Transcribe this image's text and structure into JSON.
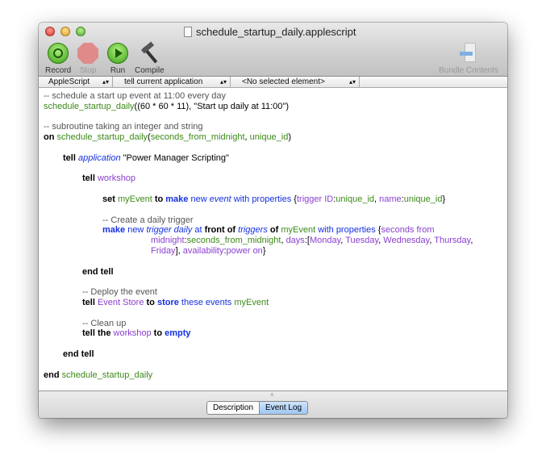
{
  "window": {
    "title": "schedule_startup_daily.applescript"
  },
  "toolbar": {
    "record": "Record",
    "stop": "Stop",
    "run": "Run",
    "compile": "Compile",
    "bundle": "Bundle Contents"
  },
  "navbar": {
    "language": "AppleScript",
    "target": "tell current application",
    "element": "<No selected element>"
  },
  "bottom_tabs": {
    "description": "Description",
    "event_log": "Event Log",
    "selected": "Event Log"
  },
  "colors": {
    "keyword": "#000000",
    "command": "#1530e0",
    "property": "#8a3fd0",
    "variable": "#3c8a18",
    "comment": "#555555"
  },
  "code": [
    {
      "i": 0,
      "t": [
        [
          "-- schedule a start up event at 11:00 every day",
          "c"
        ]
      ]
    },
    {
      "i": 0,
      "t": [
        [
          "schedule_startup_daily",
          "g"
        ],
        [
          "((60 * 60 * 11), \"Start up daily at 11:00\")",
          "n"
        ]
      ]
    },
    {
      "i": 0,
      "t": []
    },
    {
      "i": 0,
      "t": [
        [
          "-- subroutine taking an integer and string",
          "c"
        ]
      ]
    },
    {
      "i": 0,
      "t": [
        [
          "on",
          "k"
        ],
        [
          " ",
          "n"
        ],
        [
          "schedule_startup_daily",
          "g"
        ],
        [
          "(",
          "n"
        ],
        [
          "seconds_from_midnight",
          "g"
        ],
        [
          ", ",
          "n"
        ],
        [
          "unique_id",
          "g"
        ],
        [
          ")",
          "n"
        ]
      ]
    },
    {
      "i": 0,
      "t": []
    },
    {
      "i": 1,
      "t": [
        [
          "tell",
          "k"
        ],
        [
          " ",
          "n"
        ],
        [
          "application",
          "bi"
        ],
        [
          " \"Power Manager Scripting\"",
          "n"
        ]
      ]
    },
    {
      "i": 1,
      "t": []
    },
    {
      "i": 2,
      "t": [
        [
          "tell",
          "k"
        ],
        [
          " ",
          "n"
        ],
        [
          "workshop",
          "p"
        ]
      ]
    },
    {
      "i": 2,
      "t": []
    },
    {
      "i": 3,
      "t": [
        [
          "set",
          "k"
        ],
        [
          " ",
          "n"
        ],
        [
          "myEvent",
          "g"
        ],
        [
          " ",
          "n"
        ],
        [
          "to",
          "k"
        ],
        [
          " ",
          "n"
        ],
        [
          "make",
          "kb"
        ],
        [
          " new ",
          "b"
        ],
        [
          "event",
          "bi"
        ],
        [
          " with properties ",
          "b"
        ],
        [
          "{",
          "n"
        ],
        [
          "trigger ID",
          "p"
        ],
        [
          ":",
          "n"
        ],
        [
          "unique_id",
          "g"
        ],
        [
          ", ",
          "n"
        ],
        [
          "name",
          "p"
        ],
        [
          ":",
          "n"
        ],
        [
          "unique_id",
          "g"
        ],
        [
          "}",
          "n"
        ]
      ]
    },
    {
      "i": 3,
      "t": []
    },
    {
      "i": 3,
      "t": [
        [
          "-- Create a daily trigger",
          "c"
        ]
      ]
    },
    {
      "i": 3,
      "t": [
        [
          "make",
          "kb"
        ],
        [
          " new ",
          "b"
        ],
        [
          "trigger daily",
          "bi"
        ],
        [
          " at ",
          "b"
        ],
        [
          "front of",
          "k"
        ],
        [
          " ",
          "n"
        ],
        [
          "triggers",
          "bi"
        ],
        [
          " ",
          "n"
        ],
        [
          "of",
          "k"
        ],
        [
          " ",
          "n"
        ],
        [
          "myEvent",
          "g"
        ],
        [
          " with properties ",
          "b"
        ],
        [
          "{",
          "n"
        ],
        [
          "seconds from",
          "p"
        ]
      ]
    },
    {
      "i": 4,
      "t": [
        [
          "midnight",
          "p"
        ],
        [
          ":",
          "n"
        ],
        [
          "seconds_from_midnight",
          "g"
        ],
        [
          ", ",
          "n"
        ],
        [
          "days",
          "p"
        ],
        [
          ":[",
          "n"
        ],
        [
          "Monday",
          "p"
        ],
        [
          ", ",
          "n"
        ],
        [
          "Tuesday",
          "p"
        ],
        [
          ", ",
          "n"
        ],
        [
          "Wednesday",
          "p"
        ],
        [
          ", ",
          "n"
        ],
        [
          "Thursday",
          "p"
        ],
        [
          ",",
          "n"
        ]
      ]
    },
    {
      "i": 4,
      "t": [
        [
          "Friday",
          "p"
        ],
        [
          "], ",
          "n"
        ],
        [
          "availability",
          "p"
        ],
        [
          ":",
          "n"
        ],
        [
          "power on",
          "p"
        ],
        [
          "}",
          "n"
        ]
      ]
    },
    {
      "i": 3,
      "t": []
    },
    {
      "i": 2,
      "t": [
        [
          "end tell",
          "k"
        ]
      ]
    },
    {
      "i": 2,
      "t": []
    },
    {
      "i": 2,
      "t": [
        [
          "-- Deploy the event",
          "c"
        ]
      ]
    },
    {
      "i": 2,
      "t": [
        [
          "tell",
          "k"
        ],
        [
          " ",
          "n"
        ],
        [
          "Event Store",
          "p"
        ],
        [
          " ",
          "n"
        ],
        [
          "to",
          "k"
        ],
        [
          " ",
          "n"
        ],
        [
          "store",
          "kb"
        ],
        [
          " these events ",
          "b"
        ],
        [
          "myEvent",
          "g"
        ]
      ]
    },
    {
      "i": 2,
      "t": []
    },
    {
      "i": 2,
      "t": [
        [
          "-- Clean up",
          "c"
        ]
      ]
    },
    {
      "i": 2,
      "t": [
        [
          "tell the",
          "k"
        ],
        [
          " ",
          "n"
        ],
        [
          "workshop",
          "p"
        ],
        [
          " ",
          "n"
        ],
        [
          "to",
          "k"
        ],
        [
          " ",
          "n"
        ],
        [
          "empty",
          "kb"
        ]
      ]
    },
    {
      "i": 1,
      "t": []
    },
    {
      "i": 1,
      "t": [
        [
          "end tell",
          "k"
        ]
      ]
    },
    {
      "i": 0,
      "t": []
    },
    {
      "i": 0,
      "t": [
        [
          "end",
          "k"
        ],
        [
          " ",
          "n"
        ],
        [
          "schedule_startup_daily",
          "g"
        ]
      ]
    }
  ]
}
